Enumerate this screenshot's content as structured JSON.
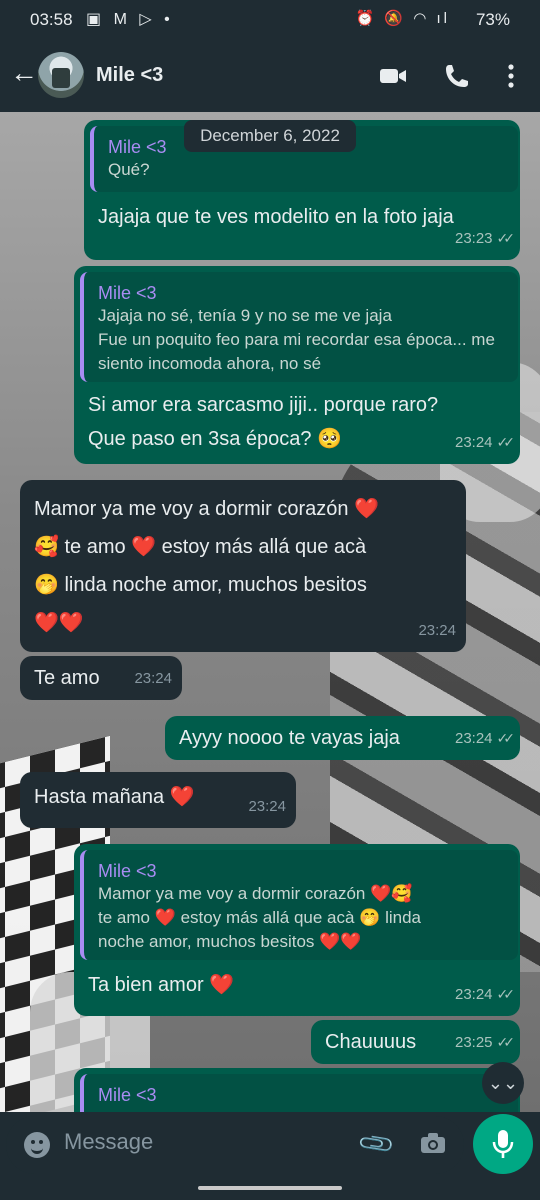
{
  "status_bar": {
    "time": "03:58",
    "battery": "73%"
  },
  "header": {
    "contact_name": "Mile <3"
  },
  "chat": {
    "date_chip": "December 6, 2022",
    "messages": [
      {
        "direction": "out",
        "quote": {
          "name": "Mile <3",
          "text": "Qué?"
        },
        "text": "Jajaja que te ves modelito en la foto jaja",
        "time": "23:23"
      },
      {
        "direction": "out",
        "quote": {
          "name": "Mile <3",
          "text": "Jajaja no sé, tenía 9 y no se me ve jaja\nFue un poquito feo para mi recordar esa época... me siento incomoda ahora, no sé"
        },
        "text": "Si amor era sarcasmo jiji.. porque raro?\nQue paso en 3sa época? 🥺",
        "time": "23:24"
      },
      {
        "direction": "in",
        "text": "Mamor ya me voy a dormir corazón ❤️\n🥰 te amo ❤️ estoy más allá que acà\n🤭 linda noche amor, muchos besitos\n❤️❤️",
        "time": "23:24"
      },
      {
        "direction": "in",
        "text": "Te amo",
        "time": "23:24"
      },
      {
        "direction": "out",
        "text": "Ayyy noooo te vayas jaja",
        "time": "23:24"
      },
      {
        "direction": "in",
        "text": "Hasta mañana ❤️",
        "time": "23:24"
      },
      {
        "direction": "out",
        "quote": {
          "name": "Mile <3",
          "text": "Mamor ya me voy a dormir corazón ❤️🥰\nte amo ❤️ estoy más allá que acà 🤭 linda\nnoche amor, muchos besitos ❤️❤️"
        },
        "text": "Ta bien amor ❤️",
        "time": "23:24"
      },
      {
        "direction": "out",
        "text": "Chauuuus",
        "time": "23:25"
      },
      {
        "direction": "out",
        "quote": {
          "name": "Mile <3",
          "text": ""
        },
        "text": "",
        "time": ""
      }
    ]
  },
  "input": {
    "placeholder": "Message"
  },
  "colors": {
    "outgoing": "#005c4b",
    "incoming": "#202c33",
    "accent": "#00a884",
    "quote_name": "#a88cf2"
  },
  "icons": [
    "back-arrow-icon",
    "video-call-icon",
    "voice-call-icon",
    "more-vert-icon",
    "emoji-icon",
    "attach-icon",
    "camera-icon",
    "mic-icon",
    "scroll-down-icon"
  ]
}
